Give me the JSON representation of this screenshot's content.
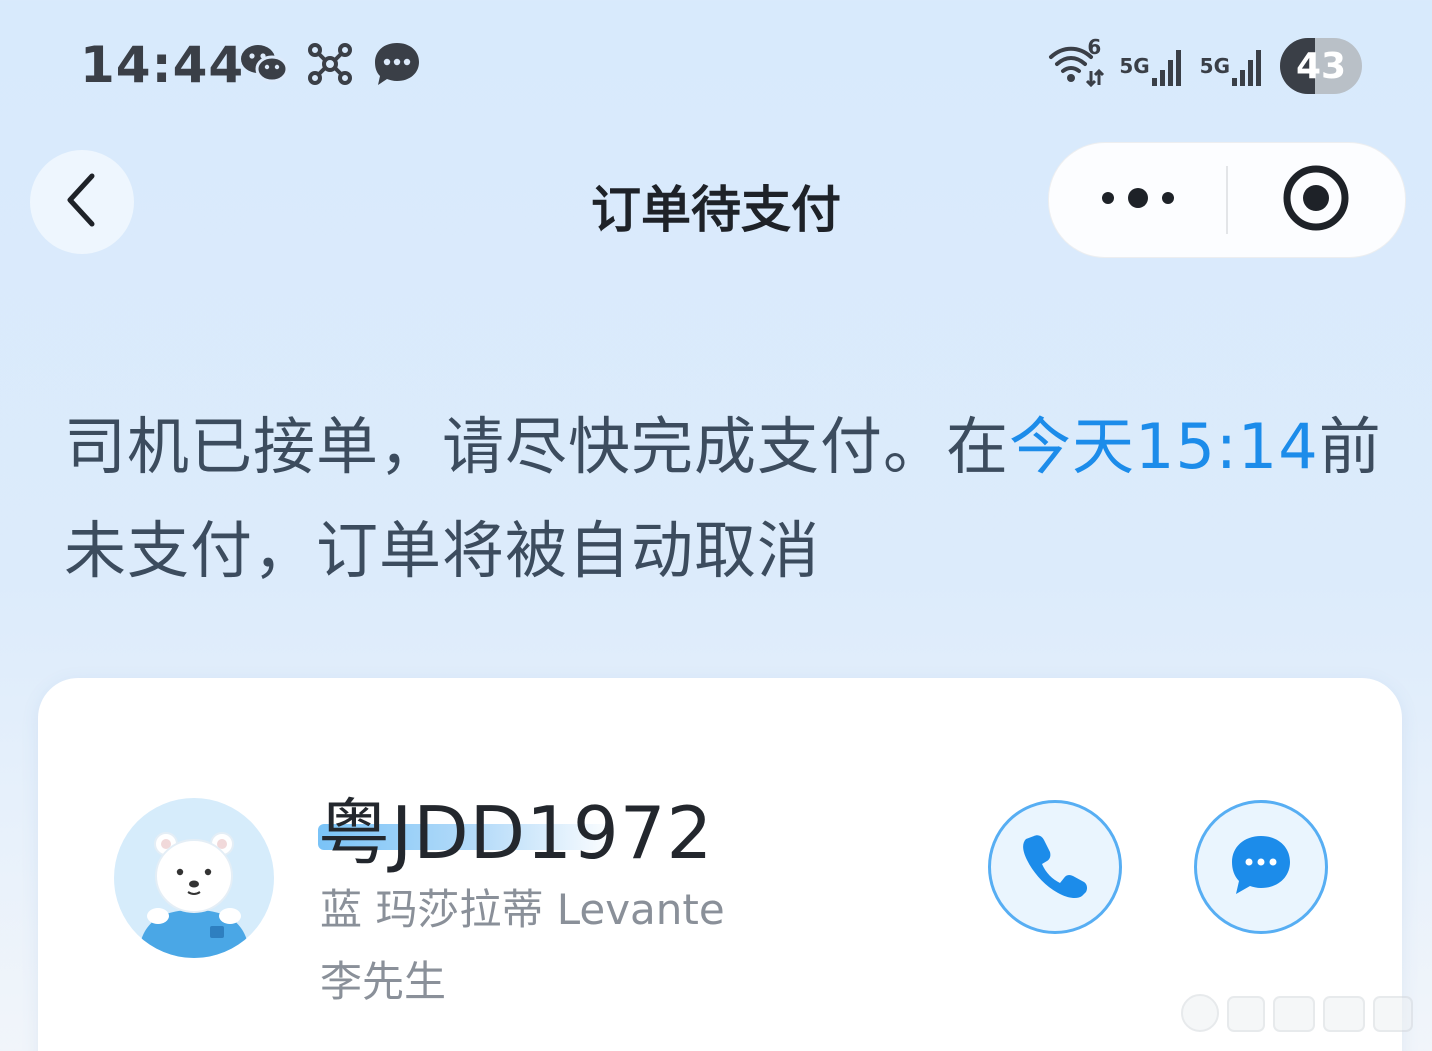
{
  "status_bar": {
    "time": "14:44",
    "left_icons": [
      "wechat-icon",
      "network-cluster-icon",
      "message-bubble-icon"
    ],
    "wifi_badge": "6",
    "signal_1_label": "5G",
    "signal_2_label": "5G",
    "battery_level": "43",
    "battery_fraction": 0.43
  },
  "nav": {
    "title": "订单待支付"
  },
  "notice": {
    "text_before": "司机已接单，请尽快完成支付。在",
    "deadline": "今天15:14",
    "text_after": "前未支付，订单将被自动取消"
  },
  "driver": {
    "plate": "粤JDD1972",
    "car_model": "蓝 玛莎拉蒂 Levante",
    "name": "李先生"
  },
  "colors": {
    "accent": "#1c8cea",
    "notice_text": "#3c4c5e",
    "plate_underline": "#7ac3f7",
    "button_border": "#57aef3"
  }
}
